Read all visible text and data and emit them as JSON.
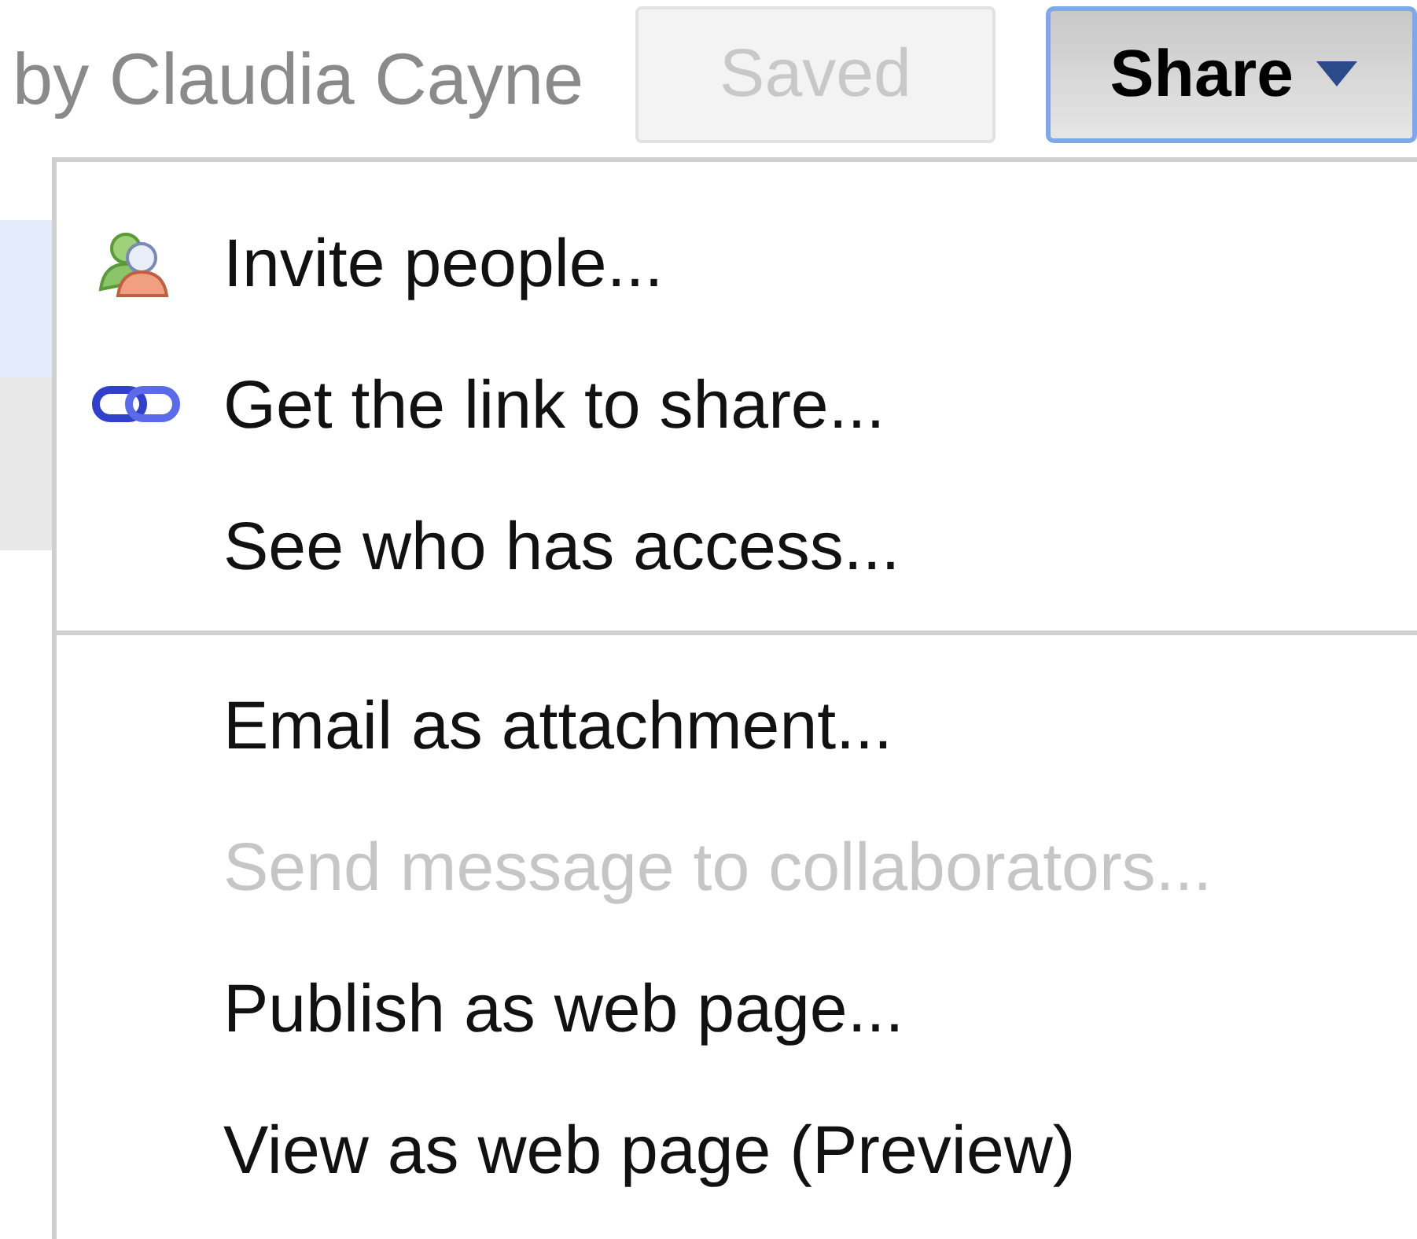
{
  "header": {
    "author": "by Claudia Cayne",
    "saved_button": {
      "label": "Saved",
      "disabled": true
    },
    "share_button": {
      "label": "Share"
    }
  },
  "share_menu": {
    "groups": [
      {
        "items": [
          {
            "label": "Invite people...",
            "kind": "people",
            "disabled": false
          },
          {
            "label": "Get the link to share...",
            "kind": "link",
            "disabled": false
          },
          {
            "label": "See who has access...",
            "kind": "plain",
            "disabled": false
          }
        ]
      },
      {
        "items": [
          {
            "label": "Email as attachment...",
            "kind": "plain",
            "disabled": false
          },
          {
            "label": "Send message to collaborators...",
            "kind": "plain",
            "disabled": true
          },
          {
            "label": "Publish as web page...",
            "kind": "plain",
            "disabled": false
          },
          {
            "label": "View as web page (Preview)",
            "kind": "plain",
            "disabled": false
          }
        ]
      }
    ]
  }
}
